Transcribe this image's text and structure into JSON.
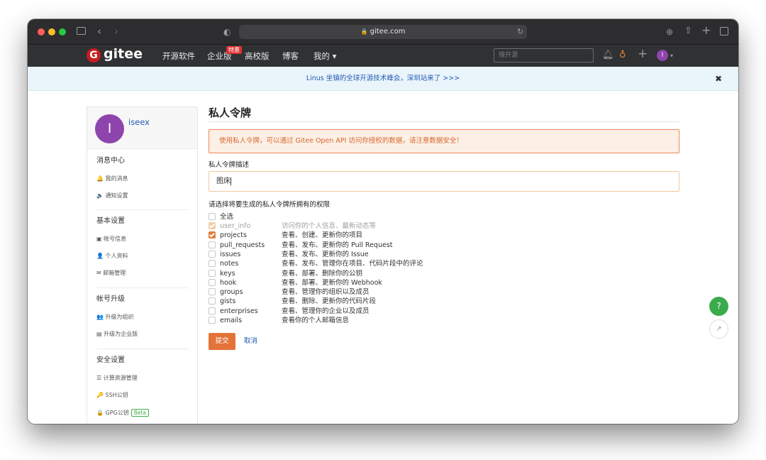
{
  "browser": {
    "url": "gitee.com",
    "lock_icon": "🔒",
    "colors": {
      "close": "#ff5f57",
      "minimize": "#febc2e",
      "maximize": "#28c840"
    }
  },
  "nav": {
    "logo_icon": "G",
    "logo_text": "gitee",
    "links": [
      "开源软件",
      "企业版",
      "高校版",
      "博客",
      "我的 ▾"
    ],
    "hot_badge": "特惠",
    "search_placeholder": "搜开源",
    "avatar_letter": "I"
  },
  "announcement": {
    "text": "Linus 坐镇的全球开源技术峰会，深圳站来了 >>>",
    "close": "✖"
  },
  "sidebar": {
    "avatar_letter": "I",
    "username": "iseex",
    "sections": [
      {
        "title": "消息中心",
        "items": [
          {
            "icon": "🔔",
            "label": "我的消息"
          },
          {
            "icon": "🔈",
            "label": "通知设置"
          }
        ]
      },
      {
        "title": "基本设置",
        "items": [
          {
            "icon": "▣",
            "label": "帐号信息"
          },
          {
            "icon": "👤",
            "label": "个人资料"
          },
          {
            "icon": "✉",
            "label": "邮箱管理"
          }
        ]
      },
      {
        "title": "帐号升级",
        "items": [
          {
            "icon": "👥",
            "label": "升级为组织"
          },
          {
            "icon": "▤",
            "label": "升级为企业版"
          }
        ]
      },
      {
        "title": "安全设置",
        "items": [
          {
            "icon": "☰",
            "label": "计算资源管理"
          },
          {
            "icon": "🔑",
            "label": "SSH公钥"
          },
          {
            "icon": "🔒",
            "label": "GPG公钥"
          }
        ]
      }
    ],
    "beta_badge": "Beta"
  },
  "main": {
    "title": "私人令牌",
    "warning": "使用私人令牌，可以通过 Gitee Open API 访问你授权的数据，请注意数据安全！",
    "desc_label": "私人令牌描述",
    "desc_value": "图床",
    "perm_label": "请选择将要生成的私人令牌所拥有的权限",
    "select_all": "全选",
    "permissions": [
      {
        "name": "user_info",
        "desc": "访问你的个人信息、最新动态等",
        "state": "disabled"
      },
      {
        "name": "projects",
        "desc": "查看、创建、更新你的项目",
        "state": "checked"
      },
      {
        "name": "pull_requests",
        "desc": "查看、发布、更新你的 Pull Request",
        "state": "unchecked"
      },
      {
        "name": "issues",
        "desc": "查看、发布、更新你的 Issue",
        "state": "unchecked"
      },
      {
        "name": "notes",
        "desc": "查看、发布、管理你在项目、代码片段中的评论",
        "state": "unchecked"
      },
      {
        "name": "keys",
        "desc": "查看、部署、删除你的公钥",
        "state": "unchecked"
      },
      {
        "name": "hook",
        "desc": "查看、部署、更新你的 Webhook",
        "state": "unchecked"
      },
      {
        "name": "groups",
        "desc": "查看、管理你的组织以及成员",
        "state": "unchecked"
      },
      {
        "name": "gists",
        "desc": "查看、删除、更新你的代码片段",
        "state": "unchecked"
      },
      {
        "name": "enterprises",
        "desc": "查看、管理你的企业以及成员",
        "state": "unchecked"
      },
      {
        "name": "emails",
        "desc": "查看你的个人邮箱信息",
        "state": "unchecked"
      }
    ],
    "submit_label": "提交",
    "cancel_label": "取消"
  },
  "floating": {
    "help": "?",
    "share": "↗"
  }
}
